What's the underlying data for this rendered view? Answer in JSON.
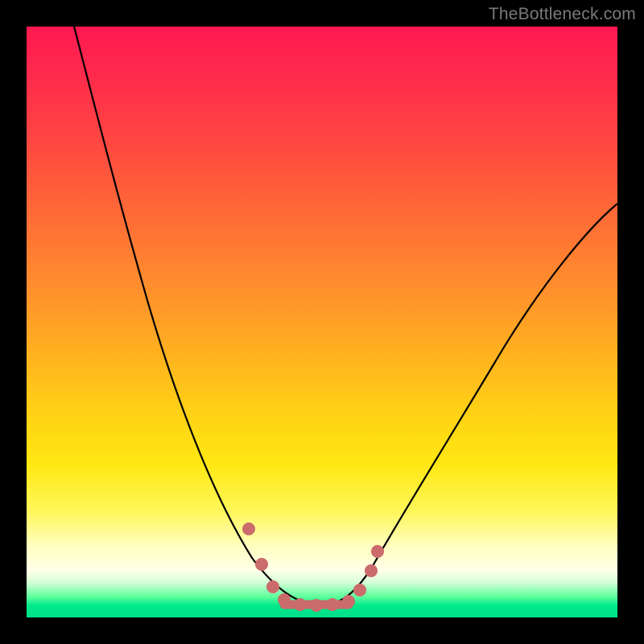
{
  "watermark": "TheBottleneck.com",
  "chart_data": {
    "type": "line",
    "title": "",
    "xlabel": "",
    "ylabel": "",
    "xlim": [
      0,
      100
    ],
    "ylim": [
      0,
      100
    ],
    "series": [
      {
        "name": "bottleneck-curve",
        "x": [
          8,
          10,
          12,
          14,
          16,
          18,
          20,
          22,
          24,
          26,
          28,
          30,
          32,
          34,
          36,
          38,
          40,
          42,
          44,
          46,
          48,
          50,
          52,
          56,
          60,
          64,
          68,
          72,
          76,
          80,
          84,
          88,
          92,
          96,
          100
        ],
        "y": [
          100,
          94,
          87,
          80,
          74,
          68,
          62,
          56,
          50,
          45,
          40,
          35,
          30,
          26,
          22,
          18,
          14,
          10,
          7,
          4,
          2.5,
          2,
          2.5,
          4,
          7,
          11,
          16,
          22,
          28,
          34,
          41,
          48,
          55,
          62,
          69
        ]
      }
    ],
    "markers": {
      "name": "highlight-dots",
      "x": [
        37.5,
        41,
        43,
        44.5,
        46,
        48,
        50,
        52,
        54,
        56,
        58
      ],
      "y": [
        15.5,
        10,
        6,
        4,
        3,
        2.3,
        2.1,
        2.3,
        3.2,
        5,
        10
      ],
      "flat_segment_x": [
        44,
        54
      ],
      "flat_y": 2.1
    },
    "gradient_zones": [
      {
        "label": "red",
        "y_range": [
          70,
          100
        ]
      },
      {
        "label": "orange",
        "y_range": [
          35,
          70
        ]
      },
      {
        "label": "yellow",
        "y_range": [
          12,
          35
        ]
      },
      {
        "label": "pale",
        "y_range": [
          4,
          12
        ]
      },
      {
        "label": "green",
        "y_range": [
          0,
          4
        ]
      }
    ],
    "colors": {
      "curve": "#000000",
      "markers": "#cb6b6b",
      "background_top": "#ff1850",
      "background_bottom": "#00e08a"
    }
  }
}
